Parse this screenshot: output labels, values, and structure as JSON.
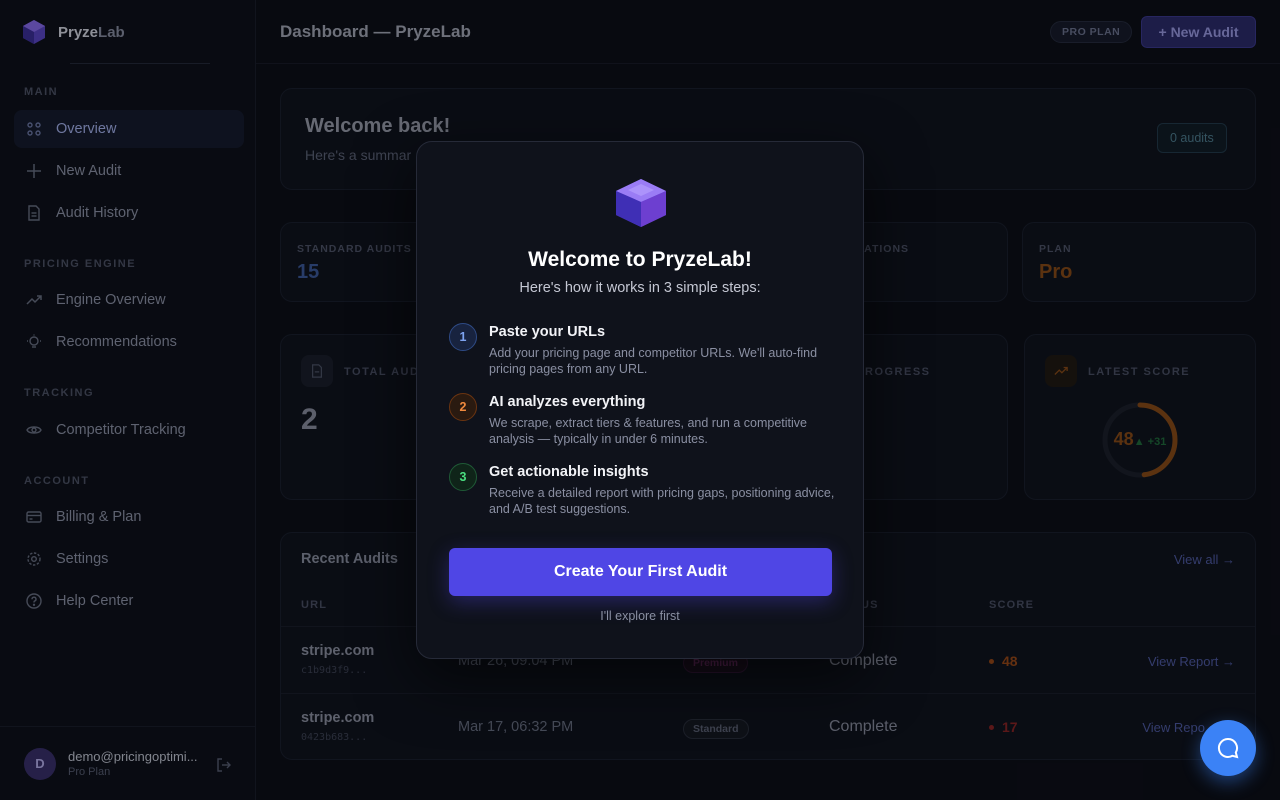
{
  "brand": {
    "name_main": "Pryze",
    "name_accent": "Lab"
  },
  "sidebar": {
    "sections": {
      "main": "MAIN",
      "pricing": "PRICING ENGINE",
      "tracking": "TRACKING",
      "account": "ACCOUNT"
    },
    "items": [
      {
        "label": "Overview",
        "icon": "grid-icon"
      },
      {
        "label": "New Audit",
        "icon": "plus-icon"
      },
      {
        "label": "Audit History",
        "icon": "document-icon"
      },
      {
        "label": "Engine Overview",
        "icon": "trend-icon"
      },
      {
        "label": "Recommendations",
        "icon": "lightbulb-icon"
      },
      {
        "label": "Competitor Tracking",
        "icon": "eye-icon"
      },
      {
        "label": "Billing & Plan",
        "icon": "card-icon"
      },
      {
        "label": "Settings",
        "icon": "gear-icon"
      },
      {
        "label": "Help Center",
        "icon": "help-icon"
      }
    ],
    "user": {
      "initial": "D",
      "email": "demo@pricingoptimi...",
      "plan": "Pro Plan"
    }
  },
  "header": {
    "title": "Dashboard — PryzeLab",
    "plan_pill": "PRO PLAN",
    "new_audit": "+ New Audit"
  },
  "welcome": {
    "title": "Welcome back!",
    "subtitle": "Here's a summar",
    "audits_pill": "0 audits"
  },
  "stats": {
    "standard_label": "STANDARD AUDITS",
    "standard_value": "15",
    "recs_label": "NDATIONS",
    "plan_label": "PLAN",
    "plan_value": "Pro"
  },
  "big_stats": {
    "total_label": "TOTAL AUDI",
    "total_value": "2",
    "progress_label": "ROGRESS",
    "latest_label": "LATEST SCORE",
    "latest_score": "48",
    "latest_delta": "▲ +31",
    "latest_fraction": 0.48
  },
  "recent": {
    "title": "Recent Audits",
    "view_all": "View all →",
    "columns": {
      "url": "URL",
      "status": "US",
      "score": "SCORE"
    },
    "rows": [
      {
        "url": "stripe.com",
        "id": "c1b9d3f9...",
        "date": "Mar 26, 09:04 PM",
        "tier": "Premium",
        "status": "Complete",
        "score": "48",
        "action": "View Report →"
      },
      {
        "url": "stripe.com",
        "id": "0423b683...",
        "date": "Mar 17, 06:32 PM",
        "tier": "Standard",
        "status": "Complete",
        "score": "17",
        "action": "View Repo"
      }
    ]
  },
  "modal": {
    "title": "Welcome to PryzeLab!",
    "subtitle": "Here's how it works in 3 simple steps:",
    "steps": [
      {
        "num": "1",
        "title": "Paste your URLs",
        "desc": "Add your pricing page and competitor URLs. We'll auto-find pricing pages from any URL."
      },
      {
        "num": "2",
        "title": "AI analyzes everything",
        "desc": "We scrape, extract tiers & features, and run a competitive analysis — typically in under 6 minutes."
      },
      {
        "num": "3",
        "title": "Get actionable insights",
        "desc": "Receive a detailed report with pricing gaps, positioning advice, and A/B test suggestions."
      }
    ],
    "cta": "Create Your First Audit",
    "secondary": "I'll explore first"
  },
  "colors": {
    "accent": "#4f46e5",
    "orange": "#c2410c",
    "red": "#dc2626",
    "green": "#22c55e",
    "chat": "#3b82f6"
  }
}
